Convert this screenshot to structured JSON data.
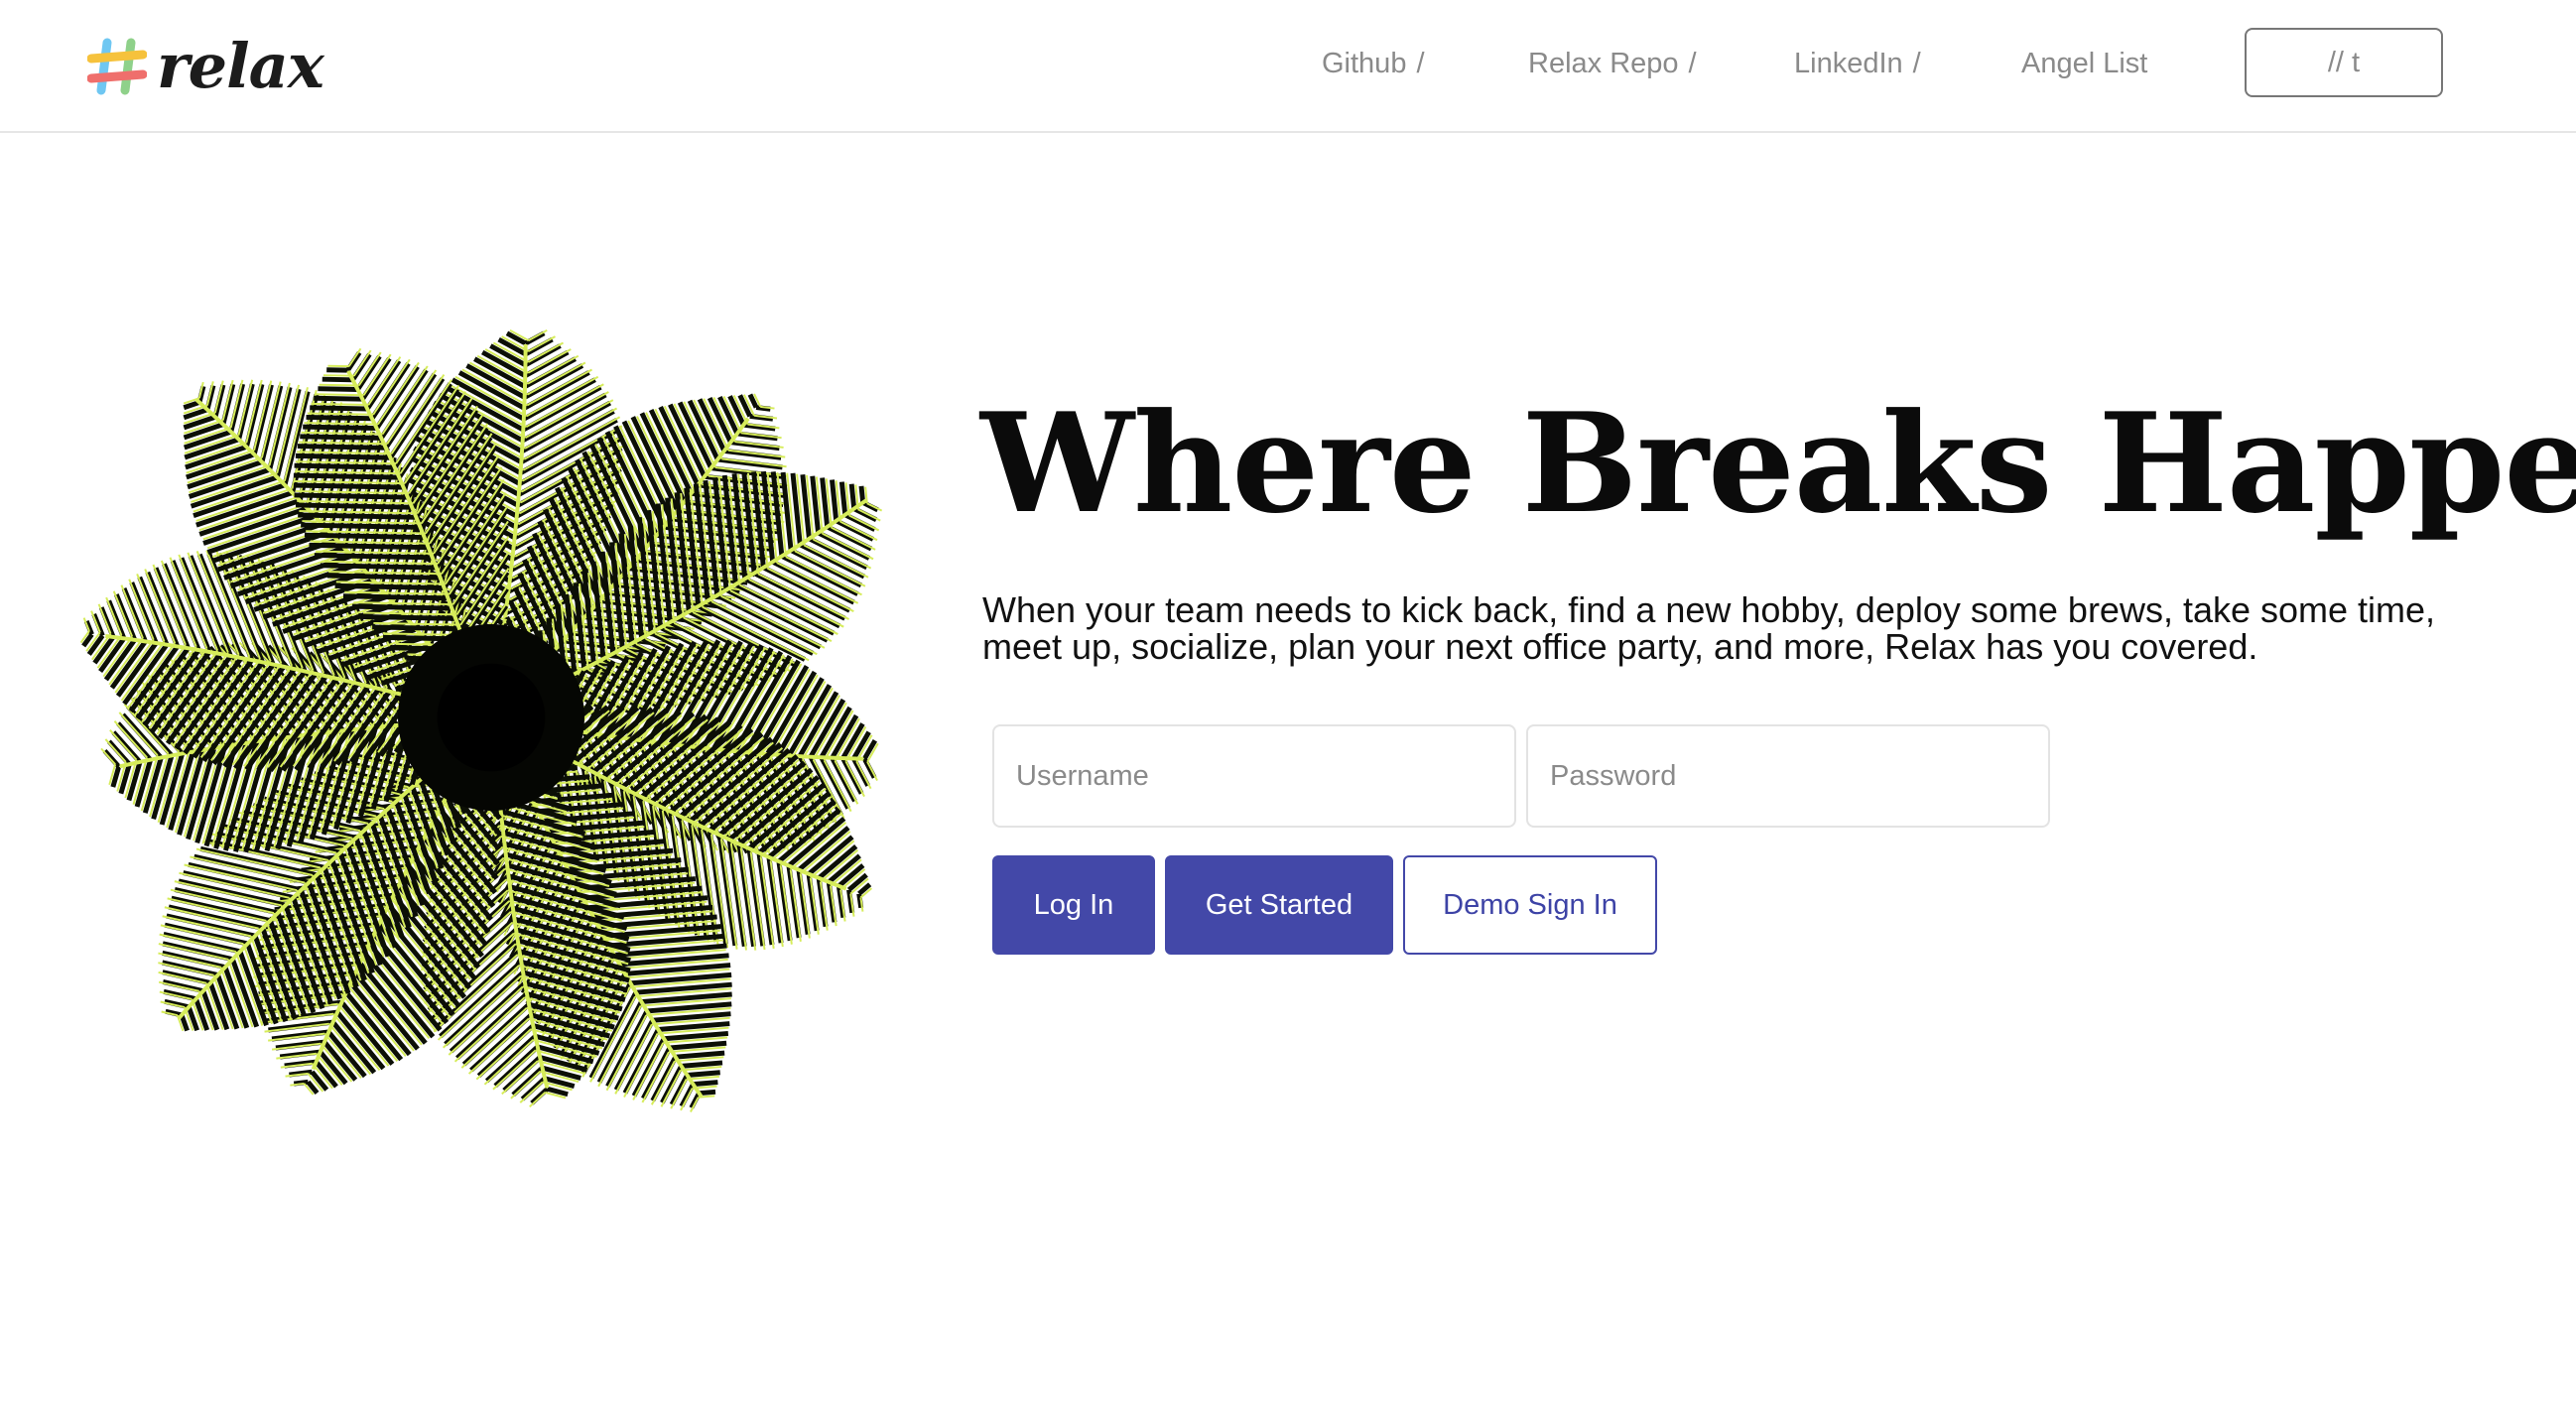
{
  "brand": {
    "name": "relax",
    "logo_icon": "colorful-hash-icon",
    "logo_colors": [
      "#6fc7f2",
      "#f6c23c",
      "#ef6f6c",
      "#8fd18a"
    ]
  },
  "nav": {
    "links": [
      {
        "label": "Github",
        "sep": "/"
      },
      {
        "label": "Relax Repo",
        "sep": "/"
      },
      {
        "label": "LinkedIn",
        "sep": "/"
      },
      {
        "label": "Angel List",
        "sep": ""
      }
    ],
    "button_label": "// t"
  },
  "hero": {
    "image_icon": "palm-fronds-image",
    "title": "Where Breaks Happen",
    "subtitle": "When your team needs to kick back, find a new hobby, deploy some brews, take some time, meet up, socialize, plan your next office party, and more, Relax has you covered."
  },
  "form": {
    "username_placeholder": "Username",
    "username_value": "",
    "password_placeholder": "Password",
    "password_value": "",
    "login_label": "Log In",
    "get_started_label": "Get Started",
    "demo_label": "Demo Sign In"
  },
  "colors": {
    "accent": "#4348a8",
    "nav_text": "#8a8a8a",
    "frond_light": "#d6ec5a",
    "frond_dark": "#0c0f06"
  }
}
